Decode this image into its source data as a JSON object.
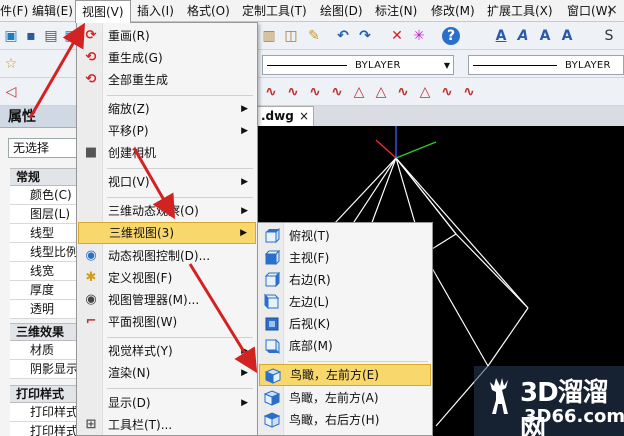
{
  "menubar": {
    "items": [
      {
        "label": "件(F)"
      },
      {
        "label": "编辑(E)"
      },
      {
        "label": "视图(V)"
      },
      {
        "label": "插入(I)"
      },
      {
        "label": "格式(O)"
      },
      {
        "label": "定制工具(T)"
      },
      {
        "label": "绘图(D)"
      },
      {
        "label": "标注(N)"
      },
      {
        "label": "修改(M)"
      },
      {
        "label": "扩展工具(X)"
      },
      {
        "label": "窗口(W)"
      }
    ],
    "close_symbol": "×"
  },
  "toolbar": {
    "linetype_value": "BYLAYER",
    "lineweight_value": "BYLAYER",
    "text_style_glyphs": [
      "A",
      "A",
      "A",
      "A",
      "S"
    ]
  },
  "properties_panel": {
    "title": "属性",
    "selection": "无选择",
    "sections": [
      {
        "name": "常规",
        "rows": [
          "颜色(C)",
          "图层(L)",
          "线型",
          "线型比例",
          "线宽",
          "厚度",
          "透明"
        ]
      },
      {
        "name": "三维效果",
        "rows": [
          "材质",
          "阴影显示"
        ]
      },
      {
        "name": "打印样式",
        "rows": [
          "打印样式",
          "打印样式"
        ]
      }
    ]
  },
  "drawing_tab": {
    "label": ".dwg",
    "close_symbol": "×"
  },
  "view_menu": {
    "items": [
      {
        "label": "重画(R)",
        "icon": "redraw-icon"
      },
      {
        "label": "重生成(G)",
        "icon": "regen-icon"
      },
      {
        "label": "全部重生成",
        "icon": "regen-all-icon"
      },
      {
        "label": "缩放(Z)",
        "submenu": true
      },
      {
        "label": "平移(P)",
        "submenu": true
      },
      {
        "label": "创建相机",
        "icon": "camera-icon"
      },
      {
        "label": "视口(V)",
        "submenu": true
      },
      {
        "label": "三维动态观察(O)",
        "submenu": true
      },
      {
        "label": "三维视图(3)",
        "submenu": true,
        "highlighted": true
      },
      {
        "label": "动态视图控制(D)...",
        "icon": "dynamic-view-icon"
      },
      {
        "label": "定义视图(F)",
        "icon": "define-view-icon"
      },
      {
        "label": "视图管理器(M)...",
        "icon": "view-manager-icon"
      },
      {
        "label": "平面视图(W)",
        "icon": "plan-view-icon"
      },
      {
        "label": "视觉样式(Y)",
        "submenu": true
      },
      {
        "label": "渲染(N)",
        "submenu": true
      },
      {
        "label": "显示(D)",
        "submenu": true
      },
      {
        "label": "工具栏(T)...",
        "icon": "toolbar-icon"
      }
    ]
  },
  "view3d_submenu": {
    "items": [
      {
        "label": "俯视(T)"
      },
      {
        "label": "主视(F)"
      },
      {
        "label": "右边(R)"
      },
      {
        "label": "左边(L)"
      },
      {
        "label": "后视(K)"
      },
      {
        "label": "底部(M)"
      },
      {
        "label": "鸟瞰，左前方(E)",
        "highlighted": true
      },
      {
        "label": "鸟瞰，左前方(A)"
      },
      {
        "label": "鸟瞰，右后方(H)"
      }
    ]
  },
  "watermark": {
    "title": "3D溜溜网",
    "subtitle": "3D66.com"
  },
  "colors": {
    "menu_highlight": "#f8d76d",
    "arrow": "#d32222",
    "canvas": "#000000",
    "wireframe": "#ffffff"
  }
}
